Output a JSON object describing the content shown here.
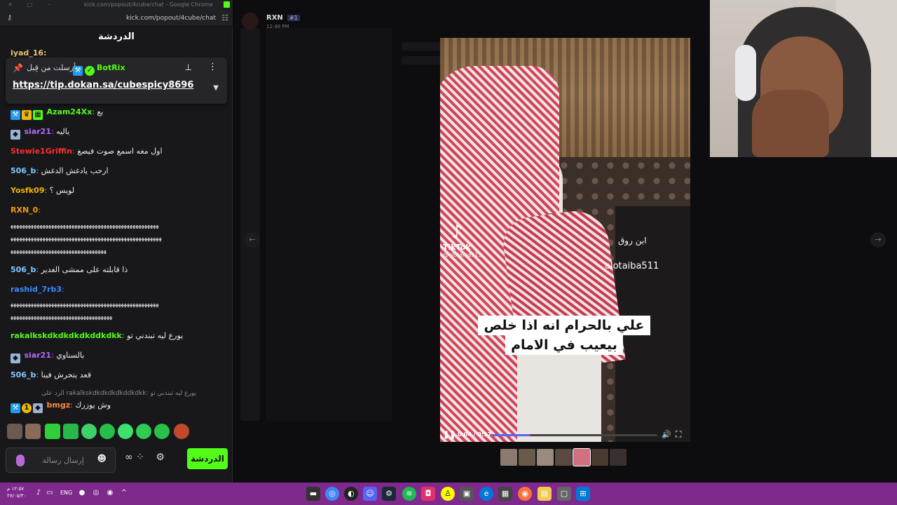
{
  "browser": {
    "window_title": "kick.com/popout/4cube/chat - Google Chrome",
    "url": "kick.com/popout/4cube/chat"
  },
  "chat": {
    "header": "الدردشة",
    "partial_top_user": "iyad_16:",
    "pinned": {
      "sent_by_label": "أرسلت من قِبل",
      "bot_name": "BotRix",
      "link": "https://tip.dokan.sa/cubespicy8696"
    },
    "messages": [
      {
        "user": "Azam24Xx",
        "color": "#53fc18",
        "text": "بع",
        "badges": [
          "hammer",
          "crown",
          "grid"
        ]
      },
      {
        "user": "siar21",
        "color": "#b36cff",
        "text": "ياليه",
        "badges": [
          "gem"
        ]
      },
      {
        "user": "Stewie1Griffin",
        "color": "#ff2d2d",
        "text": "اول مغه اسمع صوت فيصغ",
        "badges": []
      },
      {
        "user": "506_b",
        "color": "#7ec8ff",
        "text": "ارحب يادغش الدغش",
        "badges": []
      },
      {
        "user": "Yosfk09",
        "color": "#f0b400",
        "text": "لويس ؟",
        "badges": []
      },
      {
        "user": "RXN_0",
        "color": "#f39c12",
        "text": "",
        "badges": []
      },
      {
        "user": "506_b",
        "color": "#7ec8ff",
        "text": "ذا قابلته على ممشى الغدير",
        "badges": []
      },
      {
        "user": "rashid_7rb3",
        "color": "#3b8bff",
        "text": "",
        "badges": []
      },
      {
        "user": "rakalkskdkdkdkdkddkdkk",
        "color": "#53fc18",
        "text": "يورع ليه تبندني تو",
        "badges": []
      },
      {
        "user": "siar21",
        "color": "#b36cff",
        "text": "بالسناوي",
        "badges": [
          "gem"
        ]
      },
      {
        "user": "506_b",
        "color": "#7ec8ff",
        "text": "قعد يتحرش فينا",
        "badges": []
      },
      {
        "user": "bmgz",
        "color": "#ff8a3d",
        "text": "وش يوزرك",
        "badges": [
          "hammer",
          "one",
          "gem"
        ]
      }
    ],
    "spam_lines": [
      "ﻬﻬﻬﻬﻬﻬﻬﻬﻬﻬﻬﻬﻬﻬﻬﻬﻬﻬﻬﻬﻬﻬﻬﻬﻬﻬﻬﻬﻬﻬﻬﻬﻬﻬﻬﻬﻬﻬﻬﻬﻬﻬﻬﻬﻬﻬﻬﻬﻬﻬﻬ",
      "ﻬﻬﻬﻬﻬﻬﻬﻬﻬﻬﻬﻬﻬﻬﻬﻬﻬﻬﻬﻬﻬﻬﻬﻬﻬﻬﻬﻬﻬﻬﻬﻬﻬﻬﻬﻬﻬﻬﻬﻬﻬﻬﻬﻬﻬﻬﻬﻬﻬﻬﻬﻬ",
      "ﻬﻬﻬﻬﻬﻬﻬﻬﻬﻬﻬﻬﻬﻬﻬﻬﻬﻬﻬﻬﻬﻬﻬﻬﻬﻬﻬﻬﻬﻬﻬﻬﻬ",
      "ﻬﻬﻬﻬﻬﻬﻬﻬﻬﻬﻬﻬﻬﻬﻬﻬﻬﻬﻬﻬﻬﻬﻬﻬﻬﻬﻬﻬﻬﻬﻬﻬﻬﻬﻬﻬﻬﻬﻬﻬﻬﻬﻬﻬﻬﻬﻬﻬﻬﻬﻬ",
      "ﻬﻬﻬﻬﻬﻬﻬﻬﻬﻬﻬﻬﻬﻬﻬﻬﻬﻬﻬﻬﻬﻬﻬﻬﻬﻬﻬﻬﻬﻬﻬﻬﻬﻬﻬ"
    ],
    "reply_preview": "الرد على rakalkskdkdkdkdkddkdkk: يورع ليه تبندني تو",
    "input_placeholder": "إرسال رسالة",
    "send_label": "الدردشة"
  },
  "post": {
    "author": "RXN",
    "tag": "#1",
    "time": "12:48 PM"
  },
  "video": {
    "tiktok_brand": "TikTok",
    "tiktok_handle": "@alotaiba511",
    "overlay_name": "ابن روق",
    "overlay_handle": "alotaiba511",
    "subtitle_line1": "علي بالحرام انه اذا خلص",
    "subtitle_line2": "بيعيب في الامام",
    "time_display": "0:04 / 0:17",
    "progress": 0.235
  },
  "taskbar": {
    "time": "١٢:٥٧ م",
    "date": "٢٧/٠٥/٣٠",
    "lang": "ENG"
  },
  "colors": {
    "kick_green": "#53fc18",
    "taskbar": "#7d2a8c",
    "discord_blurple": "#5865f2"
  }
}
